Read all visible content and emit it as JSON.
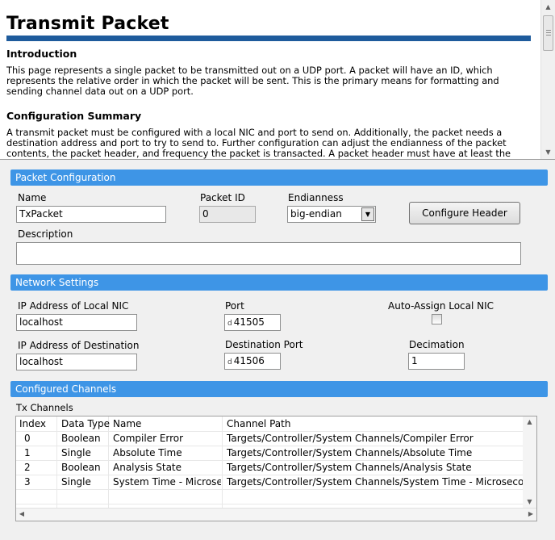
{
  "help": {
    "title": "Transmit Packet",
    "intro_heading": "Introduction",
    "intro_text": "This page represents a single packet to be transmitted out on a UDP port. A packet will have an ID, which represents the relative order in which the packet will be sent. This is the primary means for formatting and sending channel data out on a UDP port.",
    "config_heading": "Configuration Summary",
    "config_text": "A transmit packet must be configured with a local NIC and port to send on. Additionally, the packet needs a destination address and port to try to send to. Further configuration can adjust the endianness of the packet contents, the packet header, and frequency the packet is transacted. A packet header must have at least the"
  },
  "packet_config": {
    "header": "Packet Configuration",
    "name_label": "Name",
    "name_value": "TxPacket",
    "packet_id_label": "Packet ID",
    "packet_id_value": "0",
    "endianness_label": "Endianness",
    "endianness_value": "big-endian",
    "configure_header_button": "Configure Header",
    "description_label": "Description",
    "description_value": ""
  },
  "network": {
    "header": "Network Settings",
    "local_nic_label": "IP Address of Local NIC",
    "local_nic_value": "localhost",
    "port_label": "Port",
    "port_prefix": "d",
    "port_value": "41505",
    "auto_assign_label": "Auto-Assign Local NIC",
    "auto_assign_checked": false,
    "dest_label": "IP Address of Destination",
    "dest_value": "localhost",
    "dest_port_label": "Destination Port",
    "dest_port_prefix": "d",
    "dest_port_value": "41506",
    "decimation_label": "Decimation",
    "decimation_value": "1"
  },
  "channels": {
    "header": "Configured Channels",
    "tx_label": "Tx Channels",
    "columns": [
      "Index",
      "Data Type",
      "Name",
      "Channel Path"
    ],
    "rows": [
      [
        "0",
        "Boolean",
        "Compiler Error",
        "Targets/Controller/System Channels/Compiler Error"
      ],
      [
        "1",
        "Single",
        "Absolute Time",
        "Targets/Controller/System Channels/Absolute Time"
      ],
      [
        "2",
        "Boolean",
        "Analysis State",
        "Targets/Controller/System Channels/Analysis State"
      ],
      [
        "3",
        "Single",
        "System Time - Microseco",
        "Targets/Controller/System Channels/System Time - Microseconds"
      ]
    ]
  },
  "icons": {
    "scroll_up": "triangle-up-icon",
    "scroll_down": "triangle-down-icon",
    "scroll_left": "triangle-left-icon",
    "scroll_right": "triangle-right-icon",
    "dropdown": "triangle-down-icon"
  },
  "colors": {
    "section_header_bg": "#3e95e6",
    "title_underline": "#1e5b9c"
  }
}
